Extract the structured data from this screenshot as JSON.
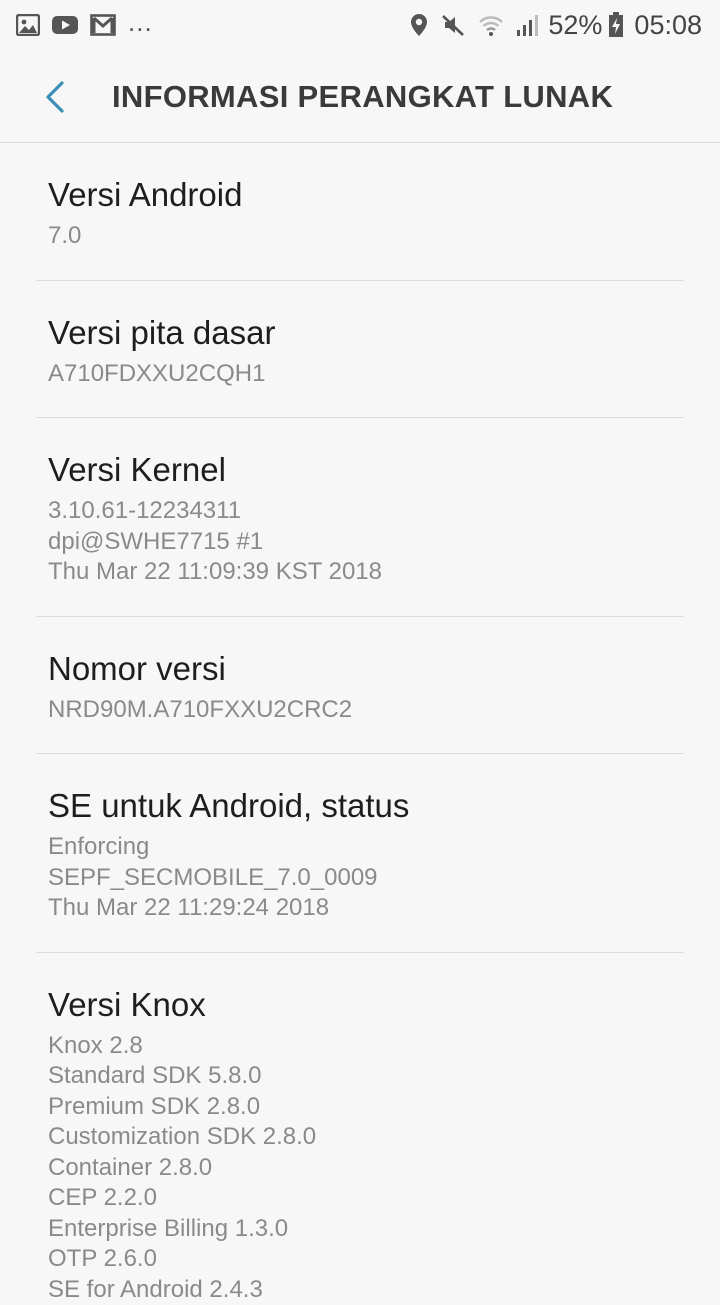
{
  "statusbar": {
    "left_icons": [
      "gallery-icon",
      "youtube-icon",
      "gmail-icon"
    ],
    "overflow": "...",
    "right_icons": [
      "location-icon",
      "mute-icon",
      "wifi-icon",
      "signal-icon",
      "battery-charging-icon"
    ],
    "battery": "52%",
    "time": "05:08"
  },
  "header": {
    "title": "INFORMASI PERANGKAT LUNAK",
    "back_icon": "back-arrow-icon",
    "accent": "#3a8fb7"
  },
  "items": [
    {
      "title": "Versi Android",
      "lines": [
        "7.0"
      ]
    },
    {
      "title": "Versi pita dasar",
      "lines": [
        "A710FDXXU2CQH1"
      ]
    },
    {
      "title": "Versi Kernel",
      "lines": [
        "3.10.61-12234311",
        "dpi@SWHE7715 #1",
        "Thu Mar 22 11:09:39 KST 2018"
      ]
    },
    {
      "title": "Nomor versi",
      "lines": [
        "NRD90M.A710FXXU2CRC2"
      ]
    },
    {
      "title": "SE untuk Android, status",
      "lines": [
        "Enforcing",
        "SEPF_SECMOBILE_7.0_0009",
        "Thu Mar 22 11:29:24 2018"
      ]
    },
    {
      "title": "Versi Knox",
      "lines": [
        "Knox 2.8",
        "Standard SDK 5.8.0",
        "Premium SDK 2.8.0",
        "Customization SDK 2.8.0",
        "Container 2.8.0",
        "CEP 2.2.0",
        "Enterprise Billing 1.3.0",
        "OTP 2.6.0",
        "SE for Android 2.4.3"
      ]
    }
  ]
}
